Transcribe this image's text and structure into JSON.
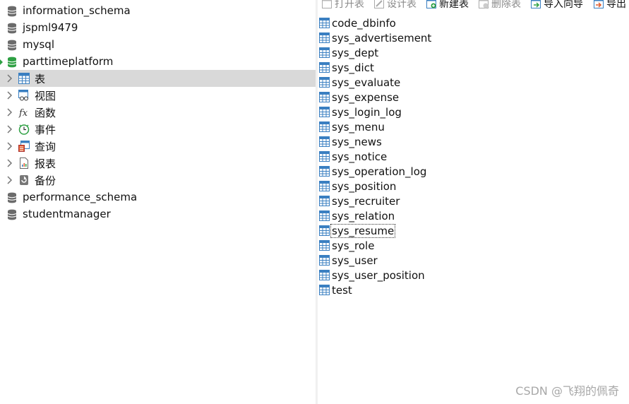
{
  "sidebar": {
    "databases_top": [
      {
        "label": "information_schema",
        "active": false
      },
      {
        "label": "jspml9479",
        "active": false
      },
      {
        "label": "mysql",
        "active": false
      },
      {
        "label": "parttimeplatform",
        "active": true
      }
    ],
    "children": [
      {
        "label": "表",
        "icon": "table-icon",
        "selected": true
      },
      {
        "label": "视图",
        "icon": "view-icon",
        "selected": false
      },
      {
        "label": "函数",
        "icon": "function-icon",
        "selected": false
      },
      {
        "label": "事件",
        "icon": "event-clock-icon",
        "selected": false
      },
      {
        "label": "查询",
        "icon": "query-icon",
        "selected": false
      },
      {
        "label": "报表",
        "icon": "report-icon",
        "selected": false
      },
      {
        "label": "备份",
        "icon": "backup-icon",
        "selected": false
      }
    ],
    "databases_bottom": [
      {
        "label": "performance_schema"
      },
      {
        "label": "studentmanager"
      }
    ]
  },
  "toolbar": {
    "open_table": "打开表",
    "design_table": "设计表",
    "new_table": "新建表",
    "delete_table": "删除表",
    "import_wizard": "导入向导",
    "export_wizard": "导出"
  },
  "tables": [
    "code_dbinfo",
    "sys_advertisement",
    "sys_dept",
    "sys_dict",
    "sys_evaluate",
    "sys_expense",
    "sys_login_log",
    "sys_menu",
    "sys_news",
    "sys_notice",
    "sys_operation_log",
    "sys_position",
    "sys_recruiter",
    "sys_relation",
    "sys_resume",
    "sys_role",
    "sys_user",
    "sys_user_position",
    "test"
  ],
  "focused_table": "sys_resume",
  "watermark": "CSDN @飞翔的佩奇",
  "colors": {
    "selection": "#d9d9d9",
    "db_active": "#2ea043",
    "db_inactive": "#6b6b6b",
    "table_icon": "#3a7fc1"
  }
}
